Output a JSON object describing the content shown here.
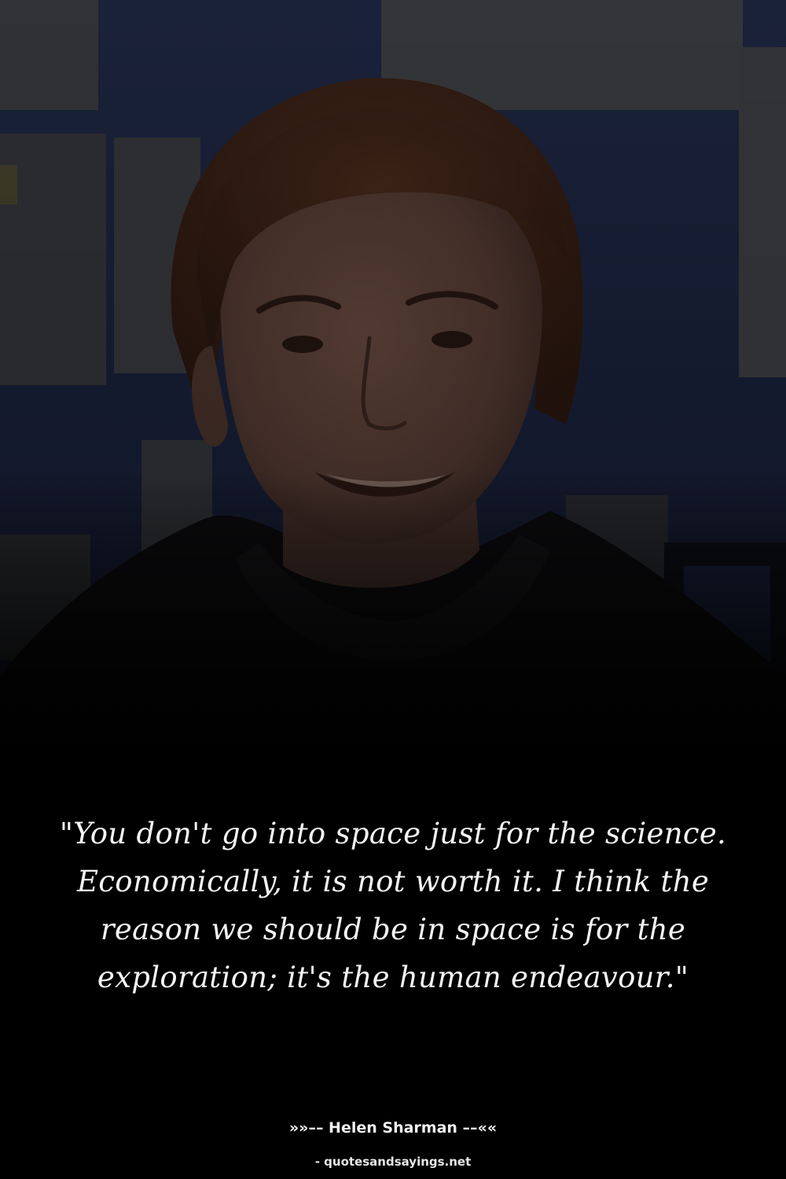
{
  "quote": {
    "text": "\"You don't go into space just for the science. Economically, it is not worth it. I think the reason we should be in space is for the exploration; it's the human endeavour.\""
  },
  "attribution": {
    "text": "»»–– Helen Sharman ––««"
  },
  "source": {
    "text": "- quotesandsayings.net"
  },
  "photo": {
    "subject": "portrait of a smiling woman with short brown hair in a dark top, office wall with notice boards behind",
    "colors": {
      "background_blue": "#1c2745",
      "wall_panel": "#3a3c40",
      "hair": "#3a2216",
      "skin": "#5a4038",
      "clothing": "#0c0c0e"
    }
  }
}
